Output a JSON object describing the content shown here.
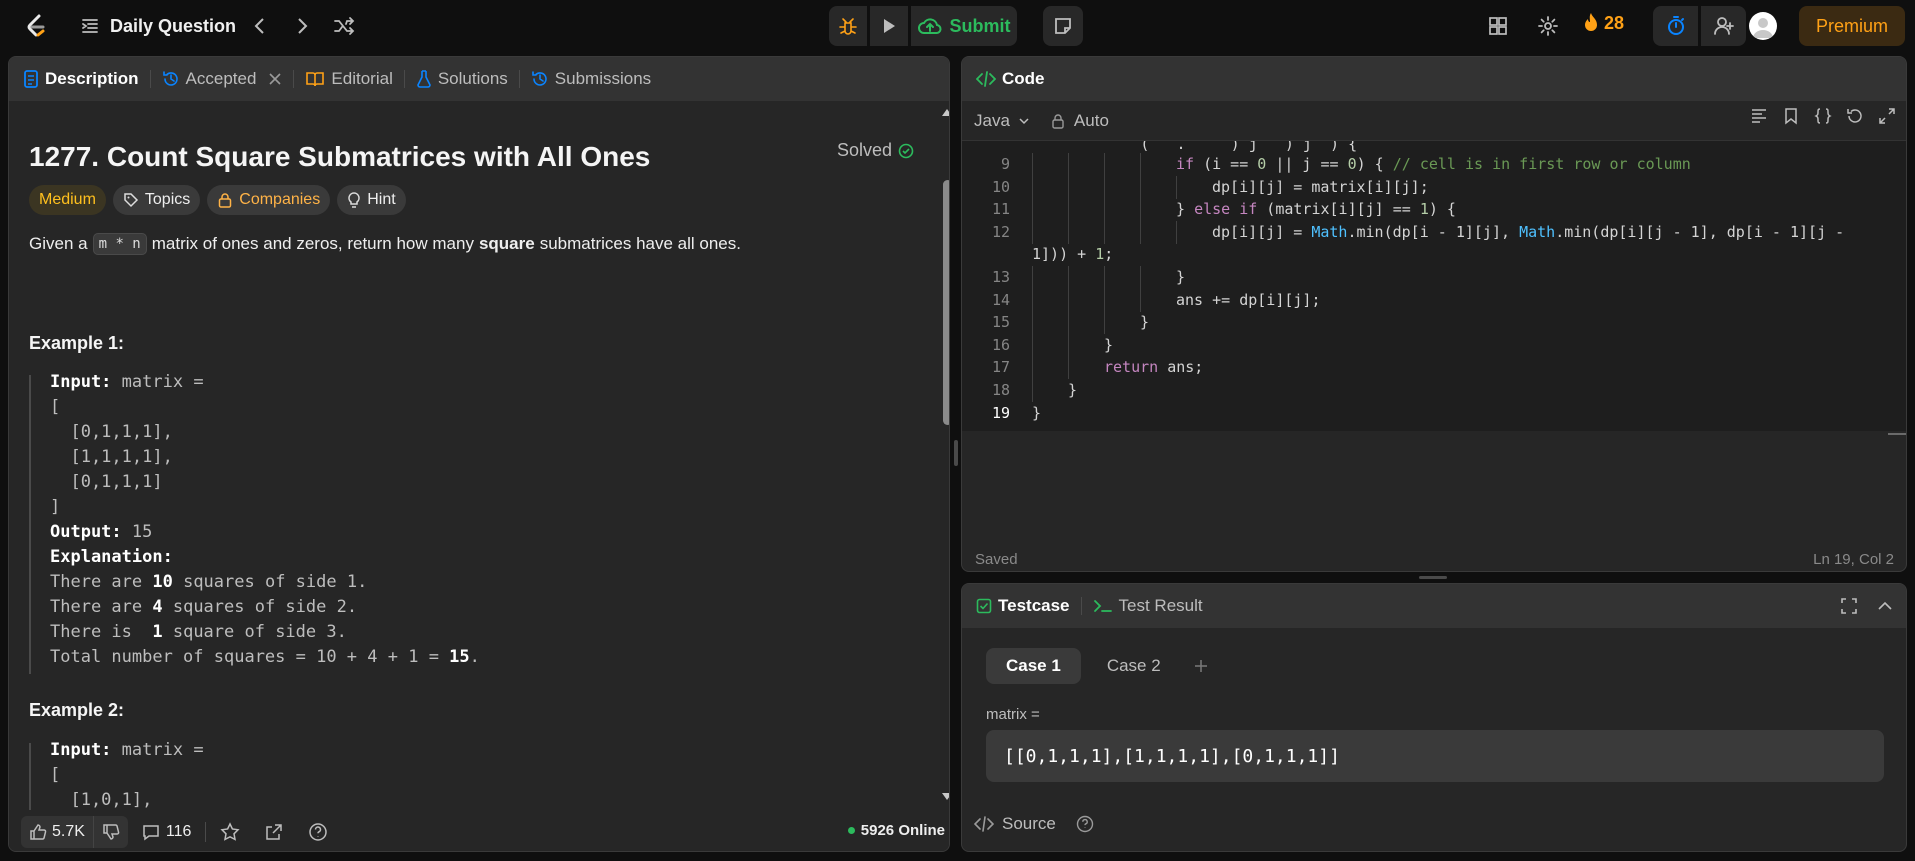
{
  "nav": {
    "daily_label": "Daily Question",
    "submit_label": "Submit",
    "streak_count": "28",
    "premium_label": "Premium"
  },
  "desc_tabs": {
    "description": "Description",
    "accepted": "Accepted",
    "editorial": "Editorial",
    "solutions": "Solutions",
    "submissions": "Submissions"
  },
  "problem": {
    "title": "1277. Count Square Submatrices with All Ones",
    "status": "Solved",
    "difficulty": "Medium",
    "topics": "Topics",
    "companies": "Companies",
    "hint": "Hint",
    "statement_pre": "Given a",
    "statement_code": "m * n",
    "statement_mid": "matrix of ones and zeros, return how many",
    "statement_bold": "square",
    "statement_post": "submatrices have all ones."
  },
  "example1": {
    "heading": "Example 1:",
    "input_label": "Input:",
    "input_value": "matrix =",
    "lines": [
      "[",
      "  [0,1,1,1],",
      "  [1,1,1,1],",
      "  [0,1,1,1]",
      "]"
    ],
    "output_label": "Output:",
    "output_value": "15",
    "explanation_label": "Explanation:",
    "exp1_pre": "There are ",
    "exp1_b": "10",
    "exp1_post": " squares of side 1.",
    "exp2_pre": "There are ",
    "exp2_b": "4",
    "exp2_post": " squares of side 2.",
    "exp3_pre": "There is  ",
    "exp3_b": "1",
    "exp3_post": " square of side 3.",
    "exp4_pre": "Total number of squares = 10 + 4 + 1 = ",
    "exp4_b": "15",
    "exp4_post": "."
  },
  "example2": {
    "heading": "Example 2:",
    "input_label": "Input:",
    "input_value": "matrix =",
    "line1": "[",
    "line2": "  [1,0,1],"
  },
  "desc_footer": {
    "likes": "5.7K",
    "comments": "116",
    "online": "5926 Online"
  },
  "code": {
    "title": "Code",
    "language": "Java",
    "mode": "Auto",
    "saved": "Saved",
    "cursor": "Ln 19, Col 2",
    "lines": [
      {
        "n": "9",
        "indent": 16,
        "parts": [
          [
            "kw",
            "if"
          ],
          [
            "t",
            " (i == "
          ],
          [
            "num",
            "0"
          ],
          [
            "t",
            " || j == "
          ],
          [
            "num",
            "0"
          ],
          [
            "t",
            ") { "
          ],
          [
            "cm",
            "// cell is in first row or column"
          ]
        ]
      },
      {
        "n": "10",
        "indent": 20,
        "parts": [
          [
            "t",
            "dp[i][j] = matrix[i][j];"
          ]
        ]
      },
      {
        "n": "11",
        "indent": 16,
        "parts": [
          [
            "t",
            "} "
          ],
          [
            "kw",
            "else if"
          ],
          [
            "t",
            " (matrix[i][j] == "
          ],
          [
            "num",
            "1"
          ],
          [
            "t",
            ") {"
          ]
        ]
      },
      {
        "n": "12",
        "indent": 20,
        "parts": [
          [
            "t",
            "dp[i][j] = "
          ],
          [
            "fn",
            "Math"
          ],
          [
            "t",
            ".min(dp[i - 1][j], "
          ],
          [
            "fn",
            "Math"
          ],
          [
            "t",
            ".min(dp[i][j - 1], dp[i - 1][j -"
          ]
        ]
      },
      {
        "n": "",
        "indent": 0,
        "parts": [
          [
            "t",
            "1])) + "
          ],
          [
            "num",
            "1"
          ],
          [
            "t",
            ";"
          ]
        ]
      },
      {
        "n": "13",
        "indent": 16,
        "parts": [
          [
            "t",
            "}"
          ]
        ]
      },
      {
        "n": "14",
        "indent": 16,
        "parts": [
          [
            "t",
            "ans += dp[i][j];"
          ]
        ]
      },
      {
        "n": "15",
        "indent": 12,
        "parts": [
          [
            "t",
            "}"
          ]
        ]
      },
      {
        "n": "16",
        "indent": 8,
        "parts": [
          [
            "t",
            "}"
          ]
        ]
      },
      {
        "n": "17",
        "indent": 8,
        "parts": [
          [
            "kw",
            "return"
          ],
          [
            "t",
            " ans;"
          ]
        ]
      },
      {
        "n": "18",
        "indent": 4,
        "parts": [
          [
            "t",
            "}"
          ]
        ]
      },
      {
        "n": "19",
        "indent": 0,
        "parts": [
          [
            "t",
            "}"
          ]
        ]
      }
    ]
  },
  "testcase": {
    "tab_testcase": "Testcase",
    "tab_result": "Test Result",
    "case1": "Case 1",
    "case2": "Case 2",
    "param_label": "matrix =",
    "param_value": "[[0,1,1,1],[1,1,1,1],[0,1,1,1]]",
    "source": "Source"
  },
  "colors": {
    "accent": "#ffa116",
    "success": "#2cbb5d",
    "medium": "#ffc01e",
    "link_blue": "#0a84ff"
  }
}
